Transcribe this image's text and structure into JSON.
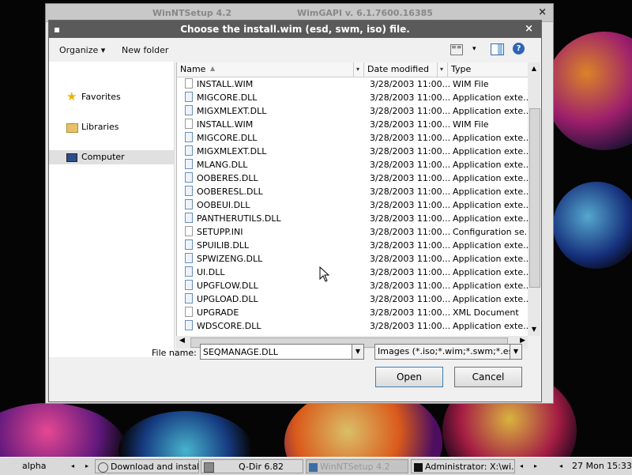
{
  "outer_window": {
    "title": "WinNTSetup 4.2",
    "subtitle": "WimGAPI v. 6.1.7600.16385",
    "close": "×"
  },
  "dialog": {
    "title": "Choose the install.wim (esd, swm, iso) file.",
    "close": "×",
    "toolbar": {
      "organize": "Organize",
      "new_folder": "New folder",
      "help": "?"
    },
    "nav": {
      "favorites": "Favorites",
      "libraries": "Libraries",
      "computer": "Computer"
    },
    "columns": {
      "name": "Name",
      "date": "Date modified",
      "type": "Type"
    },
    "files": [
      {
        "name": "INSTALL.WIM",
        "date": "3/28/2003 11:00...",
        "type": "WIM File",
        "kind": "file"
      },
      {
        "name": "MIGCORE.DLL",
        "date": "3/28/2003 11:00...",
        "type": "Application exte...",
        "kind": "dll"
      },
      {
        "name": "MIGXMLEXT.DLL",
        "date": "3/28/2003 11:00...",
        "type": "Application exte...",
        "kind": "dll"
      },
      {
        "name": "INSTALL.WIM",
        "date": "3/28/2003 11:00...",
        "type": "WIM File",
        "kind": "file"
      },
      {
        "name": "MIGCORE.DLL",
        "date": "3/28/2003 11:00...",
        "type": "Application exte...",
        "kind": "dll"
      },
      {
        "name": "MIGXMLEXT.DLL",
        "date": "3/28/2003 11:00...",
        "type": "Application exte...",
        "kind": "dll"
      },
      {
        "name": "MLANG.DLL",
        "date": "3/28/2003 11:00...",
        "type": "Application exte...",
        "kind": "dll"
      },
      {
        "name": "OOBERES.DLL",
        "date": "3/28/2003 11:00...",
        "type": "Application exte...",
        "kind": "dll"
      },
      {
        "name": "OOBERESL.DLL",
        "date": "3/28/2003 11:00...",
        "type": "Application exte...",
        "kind": "dll"
      },
      {
        "name": "OOBEUI.DLL",
        "date": "3/28/2003 11:00...",
        "type": "Application exte...",
        "kind": "dll"
      },
      {
        "name": "PANTHERUTILS.DLL",
        "date": "3/28/2003 11:00...",
        "type": "Application exte...",
        "kind": "dll"
      },
      {
        "name": "SETUPP.INI",
        "date": "3/28/2003 11:00...",
        "type": "Configuration se...",
        "kind": "file"
      },
      {
        "name": "SPUILIB.DLL",
        "date": "3/28/2003 11:00...",
        "type": "Application exte...",
        "kind": "dll"
      },
      {
        "name": "SPWIZENG.DLL",
        "date": "3/28/2003 11:00...",
        "type": "Application exte...",
        "kind": "dll"
      },
      {
        "name": "UI.DLL",
        "date": "3/28/2003 11:00...",
        "type": "Application exte...",
        "kind": "dll"
      },
      {
        "name": "UPGFLOW.DLL",
        "date": "3/28/2003 11:00...",
        "type": "Application exte...",
        "kind": "dll"
      },
      {
        "name": "UPGLOAD.DLL",
        "date": "3/28/2003 11:00...",
        "type": "Application exte...",
        "kind": "dll"
      },
      {
        "name": "UPGRADE",
        "date": "3/28/2003 11:00...",
        "type": "XML Document",
        "kind": "file"
      },
      {
        "name": "WDSCORE.DLL",
        "date": "3/28/2003 11:00...",
        "type": "Application exte...",
        "kind": "dll"
      }
    ],
    "file_name_label": "File name:",
    "file_name_value": "SEQMANAGE.DLL",
    "filter_value": "Images (*.iso;*.wim;*.swm;*.esd)",
    "open_button": "Open",
    "cancel_button": "Cancel"
  },
  "taskbar": {
    "alpha": "alpha",
    "items": [
      {
        "label": "Download and instal..."
      },
      {
        "label": "Q-Dir 6.82"
      },
      {
        "label": "WinNTSetup 4.2"
      },
      {
        "label": "Administrator: X:\\wi..."
      }
    ],
    "clock": "27 Mon 15:33"
  },
  "colors": {
    "dialog_title_bg": "#5a5a5a",
    "selection_bg": "#e0e0e0",
    "taskbar_bg": "#d9d9d9"
  }
}
